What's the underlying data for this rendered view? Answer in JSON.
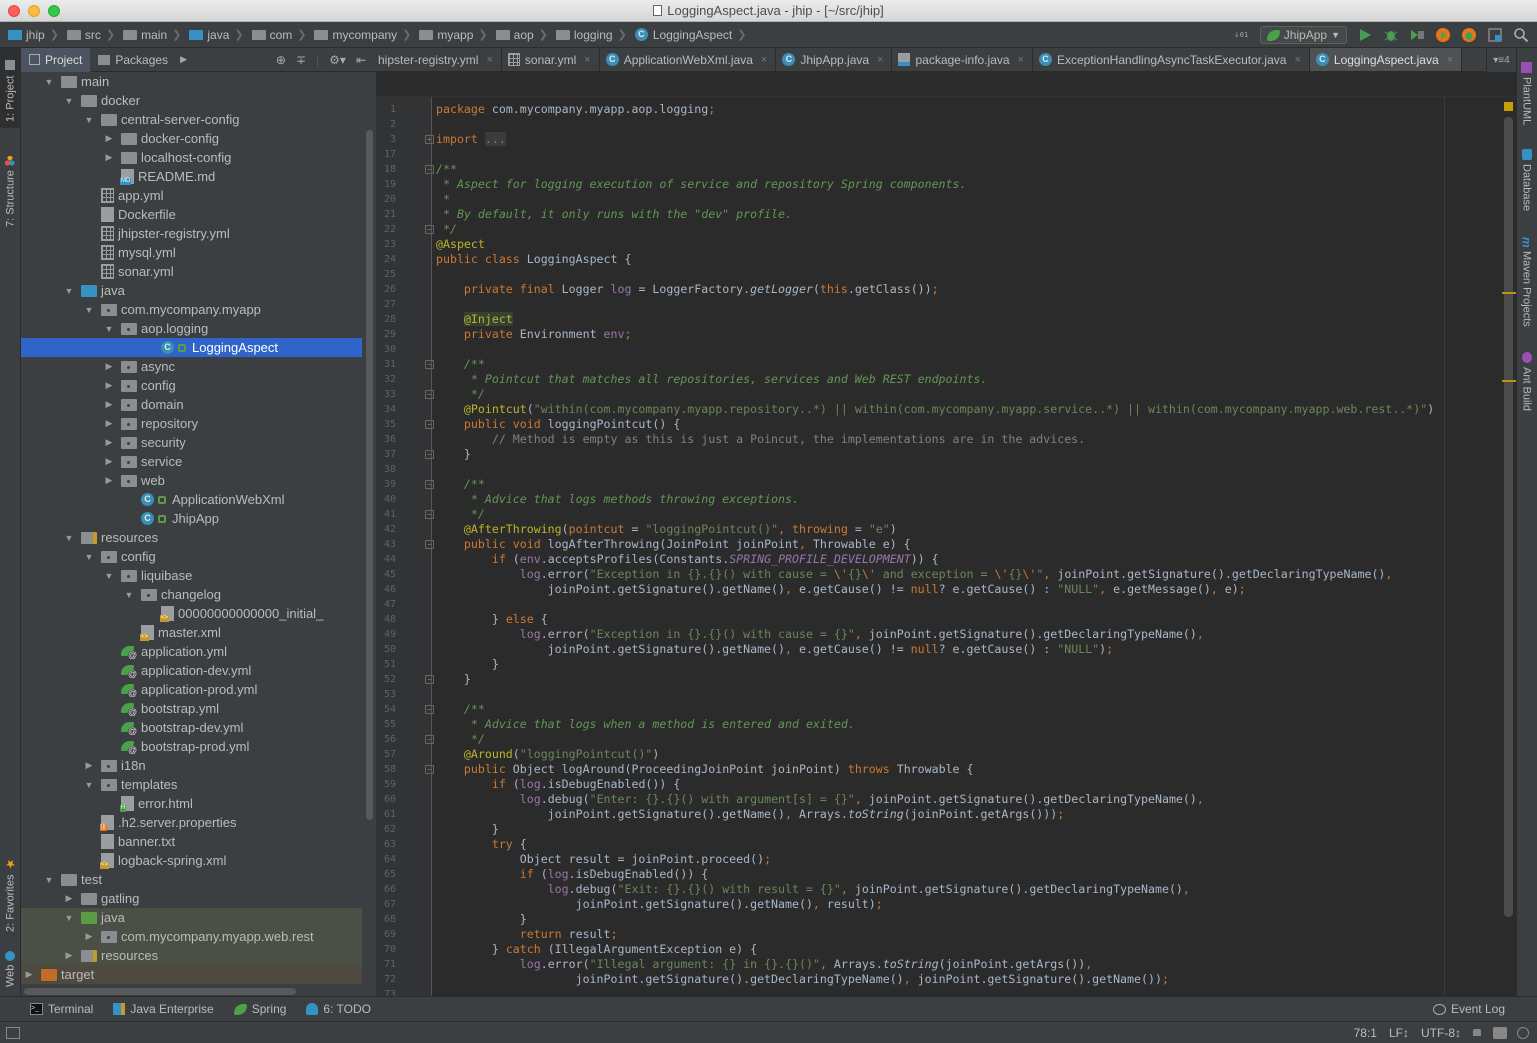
{
  "window": {
    "title": "LoggingAspect.java - jhip - [~/src/jhip]"
  },
  "breadcrumb": [
    "jhip",
    "src",
    "main",
    "java",
    "com",
    "mycompany",
    "myapp",
    "aop",
    "logging",
    "LoggingAspect"
  ],
  "run_toolbar": {
    "run_config": "JhipApp",
    "buttons": [
      "run-icon",
      "debug-icon",
      "coverage-icon",
      "profile-icon",
      "bug-icon",
      "project-structure-icon",
      "search-icon"
    ]
  },
  "left_tool_tabs": {
    "project": "1: Project",
    "structure": "7: Structure",
    "favorites": "2: Favorites",
    "web": "Web"
  },
  "right_tool_tabs": {
    "plantuml": "PlantUML",
    "database": "Database",
    "maven": "Maven Projects",
    "ant": "Ant Build"
  },
  "project_panel": {
    "tabs": [
      "Project",
      "Packages"
    ],
    "tree": [
      {
        "label": "main",
        "depth": 0,
        "arrow": "down",
        "icon": "folder"
      },
      {
        "label": "docker",
        "depth": 1,
        "arrow": "down",
        "icon": "folder"
      },
      {
        "label": "central-server-config",
        "depth": 2,
        "arrow": "down",
        "icon": "folder"
      },
      {
        "label": "docker-config",
        "depth": 3,
        "arrow": "right",
        "icon": "folder"
      },
      {
        "label": "localhost-config",
        "depth": 3,
        "arrow": "right",
        "icon": "folder"
      },
      {
        "label": "README.md",
        "depth": 3,
        "arrow": "",
        "icon": "md"
      },
      {
        "label": "app.yml",
        "depth": 2,
        "arrow": "",
        "icon": "yml"
      },
      {
        "label": "Dockerfile",
        "depth": 2,
        "arrow": "",
        "icon": "text"
      },
      {
        "label": "jhipster-registry.yml",
        "depth": 2,
        "arrow": "",
        "icon": "yml"
      },
      {
        "label": "mysql.yml",
        "depth": 2,
        "arrow": "",
        "icon": "yml"
      },
      {
        "label": "sonar.yml",
        "depth": 2,
        "arrow": "",
        "icon": "yml"
      },
      {
        "label": "java",
        "depth": 1,
        "arrow": "down",
        "icon": "folder-blue"
      },
      {
        "label": "com.mycompany.myapp",
        "depth": 2,
        "arrow": "down",
        "icon": "package"
      },
      {
        "label": "aop.logging",
        "depth": 3,
        "arrow": "down",
        "icon": "package"
      },
      {
        "label": "LoggingAspect",
        "depth": 5,
        "arrow": "",
        "icon": "class",
        "selected": true
      },
      {
        "label": "async",
        "depth": 3,
        "arrow": "right",
        "icon": "package"
      },
      {
        "label": "config",
        "depth": 3,
        "arrow": "right",
        "icon": "package"
      },
      {
        "label": "domain",
        "depth": 3,
        "arrow": "right",
        "icon": "package"
      },
      {
        "label": "repository",
        "depth": 3,
        "arrow": "right",
        "icon": "package"
      },
      {
        "label": "security",
        "depth": 3,
        "arrow": "right",
        "icon": "package"
      },
      {
        "label": "service",
        "depth": 3,
        "arrow": "right",
        "icon": "package"
      },
      {
        "label": "web",
        "depth": 3,
        "arrow": "right",
        "icon": "package"
      },
      {
        "label": "ApplicationWebXml",
        "depth": 4,
        "arrow": "",
        "icon": "class"
      },
      {
        "label": "JhipApp",
        "depth": 4,
        "arrow": "",
        "icon": "class-run"
      },
      {
        "label": "resources",
        "depth": 1,
        "arrow": "down",
        "icon": "resources"
      },
      {
        "label": "config",
        "depth": 2,
        "arrow": "down",
        "icon": "package"
      },
      {
        "label": "liquibase",
        "depth": 3,
        "arrow": "down",
        "icon": "package"
      },
      {
        "label": "changelog",
        "depth": 4,
        "arrow": "down",
        "icon": "package"
      },
      {
        "label": "00000000000000_initial_",
        "depth": 5,
        "arrow": "",
        "icon": "xml"
      },
      {
        "label": "master.xml",
        "depth": 4,
        "arrow": "",
        "icon": "xml"
      },
      {
        "label": "application.yml",
        "depth": 3,
        "arrow": "",
        "icon": "spring"
      },
      {
        "label": "application-dev.yml",
        "depth": 3,
        "arrow": "",
        "icon": "spring"
      },
      {
        "label": "application-prod.yml",
        "depth": 3,
        "arrow": "",
        "icon": "spring"
      },
      {
        "label": "bootstrap.yml",
        "depth": 3,
        "arrow": "",
        "icon": "spring"
      },
      {
        "label": "bootstrap-dev.yml",
        "depth": 3,
        "arrow": "",
        "icon": "spring"
      },
      {
        "label": "bootstrap-prod.yml",
        "depth": 3,
        "arrow": "",
        "icon": "spring"
      },
      {
        "label": "i18n",
        "depth": 2,
        "arrow": "right",
        "icon": "package"
      },
      {
        "label": "templates",
        "depth": 2,
        "arrow": "down",
        "icon": "package"
      },
      {
        "label": "error.html",
        "depth": 3,
        "arrow": "",
        "icon": "html"
      },
      {
        "label": ".h2.server.properties",
        "depth": 2,
        "arrow": "",
        "icon": "properties"
      },
      {
        "label": "banner.txt",
        "depth": 2,
        "arrow": "",
        "icon": "text"
      },
      {
        "label": "logback-spring.xml",
        "depth": 2,
        "arrow": "",
        "icon": "xml"
      },
      {
        "label": "test",
        "depth": 0,
        "arrow": "down",
        "icon": "folder"
      },
      {
        "label": "gatling",
        "depth": 1,
        "arrow": "right",
        "icon": "folder"
      },
      {
        "label": "java",
        "depth": 1,
        "arrow": "down",
        "icon": "folder-green",
        "test": true
      },
      {
        "label": "com.mycompany.myapp.web.rest",
        "depth": 2,
        "arrow": "right",
        "icon": "package",
        "test": true
      },
      {
        "label": "resources",
        "depth": 1,
        "arrow": "right",
        "icon": "resources-test",
        "test": true
      },
      {
        "label": "target",
        "depth": -1,
        "arrow": "right",
        "icon": "folder-orange",
        "excluded": true
      }
    ]
  },
  "editor_tabs": [
    {
      "label": "hipster-registry.yml",
      "icon": "yml",
      "active": false
    },
    {
      "label": "sonar.yml",
      "icon": "yml",
      "active": false
    },
    {
      "label": "ApplicationWebXml.java",
      "icon": "class",
      "active": false
    },
    {
      "label": "JhipApp.java",
      "icon": "class",
      "active": false
    },
    {
      "label": "package-info.java",
      "icon": "java-file",
      "active": false
    },
    {
      "label": "ExceptionHandlingAsyncTaskExecutor.java",
      "icon": "class",
      "active": false
    },
    {
      "label": "LoggingAspect.java",
      "icon": "class",
      "active": true
    }
  ],
  "editor_tabs_overflow": "4",
  "editor": {
    "lines": [
      {
        "n": "1",
        "html": "<span class='k'>package</span> com.mycompany.myapp.aop.logging<span class='k'>;</span>"
      },
      {
        "n": "2",
        "html": ""
      },
      {
        "n": "3",
        "html": "<span class='k'>import</span> <span class='m' style='background:#3b3b3b'>...</span>",
        "fold": "+"
      },
      {
        "n": "17",
        "html": ""
      },
      {
        "n": "18",
        "html": "<span class='c'>/**</span>",
        "fold": "-"
      },
      {
        "n": "19",
        "html": "<span class='c'> * Aspect for logging execution of service and repository Spring components.</span>"
      },
      {
        "n": "20",
        "html": "<span class='c'> *</span>"
      },
      {
        "n": "21",
        "html": "<span class='c'> * By default, it only runs with the \"dev\" profile.</span>"
      },
      {
        "n": "22",
        "html": "<span class='c'> */</span>",
        "fold": "-"
      },
      {
        "n": "23",
        "html": "<span class='a'>@Aspect</span>"
      },
      {
        "n": "24",
        "html": "<span class='k'>public class</span> LoggingAspect {"
      },
      {
        "n": "25",
        "html": ""
      },
      {
        "n": "26",
        "html": "    <span class='k'>private final</span> Logger <span class='f'>log</span> = LoggerFactory.<span class='i'>getLogger</span>(<span class='k'>this</span>.getClass())<span class='k'>;</span>"
      },
      {
        "n": "27",
        "html": ""
      },
      {
        "n": "28",
        "html": "    <span class='a' style='background:#344134'>@Inject</span>"
      },
      {
        "n": "29",
        "html": "    <span class='k'>private</span> Environment <span class='f'>env</span><span class='k'>;</span>"
      },
      {
        "n": "30",
        "html": ""
      },
      {
        "n": "31",
        "html": "    <span class='c'>/**</span>",
        "fold": "-"
      },
      {
        "n": "32",
        "html": "<span class='c'>     * Pointcut that matches all repositories, services and Web REST endpoints.</span>"
      },
      {
        "n": "33",
        "html": "<span class='c'>     */</span>",
        "fold": "-"
      },
      {
        "n": "34",
        "html": "    <span class='a'>@Pointcut</span>(<span class='s'>\"within(com.mycompany.myapp.repository..*) || within(com.mycompany.myapp.service..*) || within(com.mycompany.myapp.web.rest..*)\"</span>)"
      },
      {
        "n": "35",
        "html": "    <span class='k'>public void</span> loggingPointcut() {",
        "fold": "-"
      },
      {
        "n": "36",
        "html": "        <span class='m'>// Method is empty as this is just a Poincut, the implementations are in the advices.</span>"
      },
      {
        "n": "37",
        "html": "    }",
        "fold": "-"
      },
      {
        "n": "38",
        "html": ""
      },
      {
        "n": "39",
        "html": "    <span class='c'>/**</span>",
        "fold": "-"
      },
      {
        "n": "40",
        "html": "<span class='c'>     * Advice that logs methods throwing exceptions.</span>"
      },
      {
        "n": "41",
        "html": "<span class='c'>     */</span>",
        "fold": "-"
      },
      {
        "n": "42",
        "html": "    <span class='a'>@AfterThrowing</span>(<span class='k'>pointcut</span> = <span class='s'>\"loggingPointcut()\"</span><span class='k'>,</span> <span class='k'>throwing</span> = <span class='s'>\"e\"</span>)"
      },
      {
        "n": "43",
        "html": "    <span class='k'>public void</span> logAfterThrowing(JoinPoint joinPoint<span class='k'>,</span> Throwable e) {",
        "fold": "-"
      },
      {
        "n": "44",
        "html": "        <span class='k'>if</span> (<span class='f'>env</span>.acceptsProfiles(Constants.<span class='cn'>SPRING_PROFILE_DEVELOPMENT</span>)) {"
      },
      {
        "n": "45",
        "html": "            <span class='f'>log</span>.error(<span class='s'>\"Exception in {}.{}() with cause = </span><span class='k'>\\'</span><span class='s'>{}</span><span class='k'>\\'</span><span class='s'> and exception = </span><span class='k'>\\'</span><span class='s'>{}</span><span class='k'>\\'</span><span class='s'>\"</span><span class='k'>,</span> joinPoint.getSignature().getDeclaringTypeName()<span class='k'>,</span>"
      },
      {
        "n": "46",
        "html": "                joinPoint.getSignature().getName()<span class='k'>,</span> e.getCause() != <span class='k'>null</span>? e.getCause() : <span class='s'>\"NULL\"</span><span class='k'>,</span> e.getMessage()<span class='k'>,</span> e)<span class='k'>;</span>"
      },
      {
        "n": "47",
        "html": ""
      },
      {
        "n": "48",
        "html": "        } <span class='k'>else</span> {"
      },
      {
        "n": "49",
        "html": "            <span class='f'>log</span>.error(<span class='s'>\"Exception in {}.{}() with cause = {}\"</span><span class='k'>,</span> joinPoint.getSignature().getDeclaringTypeName()<span class='k'>,</span>"
      },
      {
        "n": "50",
        "html": "                joinPoint.getSignature().getName()<span class='k'>,</span> e.getCause() != <span class='k'>null</span>? e.getCause() : <span class='s'>\"NULL\"</span>)<span class='k'>;</span>"
      },
      {
        "n": "51",
        "html": "        }"
      },
      {
        "n": "52",
        "html": "    }",
        "fold": "-"
      },
      {
        "n": "53",
        "html": ""
      },
      {
        "n": "54",
        "html": "    <span class='c'>/**</span>",
        "fold": "-"
      },
      {
        "n": "55",
        "html": "<span class='c'>     * Advice that logs when a method is entered and exited.</span>"
      },
      {
        "n": "56",
        "html": "<span class='c'>     */</span>",
        "fold": "-"
      },
      {
        "n": "57",
        "html": "    <span class='a'>@Around</span>(<span class='s'>\"loggingPointcut()\"</span>)"
      },
      {
        "n": "58",
        "html": "    <span class='k'>public</span> Object logAround(ProceedingJoinPoint joinPoint) <span class='k'>throws</span> Throwable {",
        "fold": "-"
      },
      {
        "n": "59",
        "html": "        <span class='k'>if</span> (<span class='f'>log</span>.isDebugEnabled()) {"
      },
      {
        "n": "60",
        "html": "            <span class='f'>log</span>.debug(<span class='s'>\"Enter: {}.{}() with argument[s] = {}\"</span><span class='k'>,</span> joinPoint.getSignature().getDeclaringTypeName()<span class='k'>,</span>"
      },
      {
        "n": "61",
        "html": "                joinPoint.getSignature().getName()<span class='k'>,</span> Arrays.<span class='i'>toString</span>(joinPoint.getArgs()))<span class='k'>;</span>"
      },
      {
        "n": "62",
        "html": "        }"
      },
      {
        "n": "63",
        "html": "        <span class='k'>try</span> {"
      },
      {
        "n": "64",
        "html": "            Object result = joinPoint.proceed()<span class='k'>;</span>"
      },
      {
        "n": "65",
        "html": "            <span class='k'>if</span> (<span class='f'>log</span>.isDebugEnabled()) {"
      },
      {
        "n": "66",
        "html": "                <span class='f'>log</span>.debug(<span class='s'>\"Exit: {}.{}() with result = {}\"</span><span class='k'>,</span> joinPoint.getSignature().getDeclaringTypeName()<span class='k'>,</span>"
      },
      {
        "n": "67",
        "html": "                    joinPoint.getSignature().getName()<span class='k'>,</span> result)<span class='k'>;</span>"
      },
      {
        "n": "68",
        "html": "            }"
      },
      {
        "n": "69",
        "html": "            <span class='k'>return</span> result<span class='k'>;</span>"
      },
      {
        "n": "70",
        "html": "        } <span class='k'>catch</span> (IllegalArgumentException e) {"
      },
      {
        "n": "71",
        "html": "            <span class='f'>log</span>.error(<span class='s'>\"Illegal argument: {} in {}.{}()\"</span><span class='k'>,</span> Arrays.<span class='i'>toString</span>(joinPoint.getArgs())<span class='k'>,</span>"
      },
      {
        "n": "72",
        "html": "                    joinPoint.getSignature().getDeclaringTypeName()<span class='k'>,</span> joinPoint.getSignature().getName())<span class='k'>;</span>"
      },
      {
        "n": "73",
        "html": ""
      }
    ]
  },
  "bottom_tool_tabs": [
    {
      "label": "Terminal",
      "icon": "terminal-icon"
    },
    {
      "label": "Java Enterprise",
      "icon": "java-enterprise-icon"
    },
    {
      "label": "Spring",
      "icon": "spring-icon"
    },
    {
      "label": "6: TODO",
      "icon": "todo-icon"
    }
  ],
  "event_log": "Event Log",
  "status": {
    "position": "78:1",
    "line_separator": "LF↕",
    "encoding": "UTF-8↕"
  }
}
